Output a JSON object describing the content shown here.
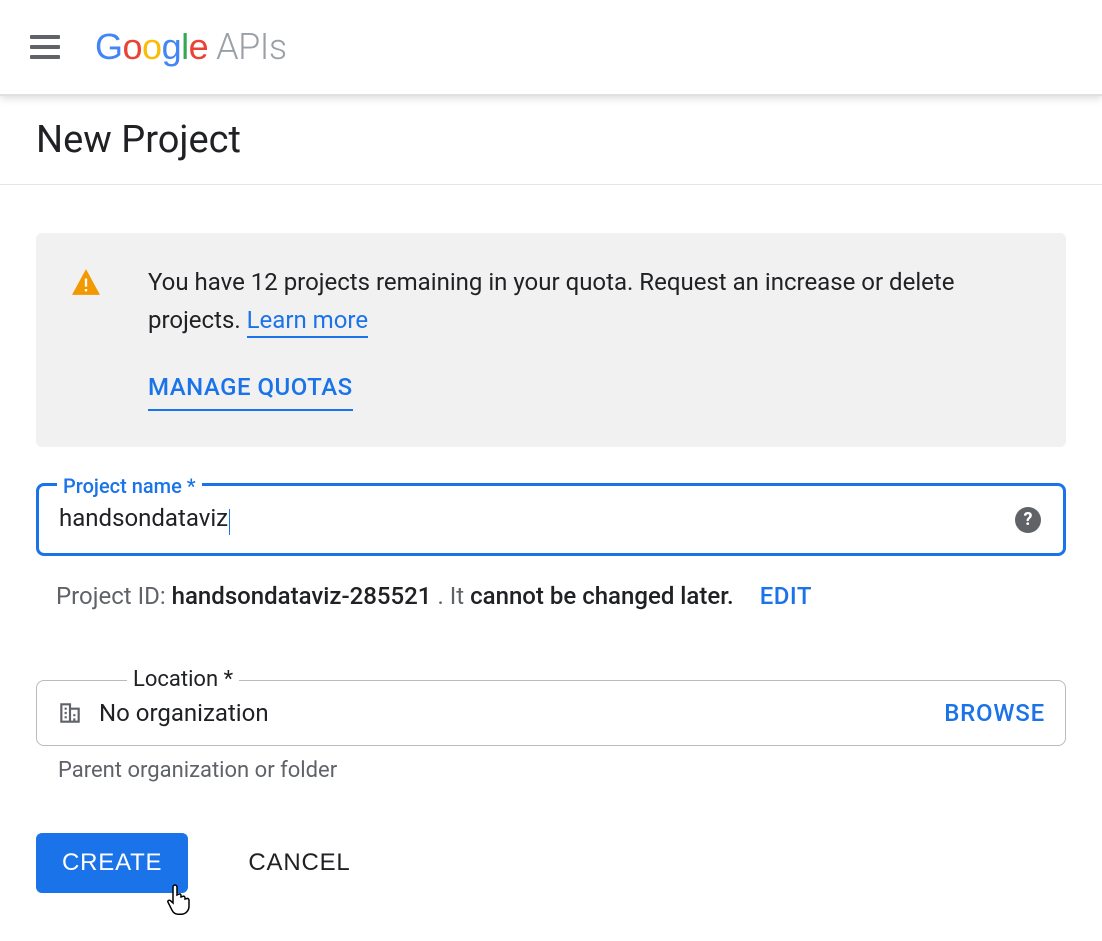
{
  "header": {
    "logo_suffix": "APIs"
  },
  "page": {
    "title": "New Project"
  },
  "alert": {
    "message_part1": "You have 12 projects remaining in your quota. Request an increase or delete projects. ",
    "learn_more": "Learn more",
    "manage_quotas": "MANAGE QUOTAS"
  },
  "project_name_field": {
    "label": "Project name *",
    "value": "handsondataviz"
  },
  "project_id_row": {
    "prefix": "Project ID:",
    "id": "handsondataviz-285521",
    "mid": ". It",
    "cannot": "cannot be changed later.",
    "edit": "EDIT"
  },
  "location_field": {
    "label": "Location *",
    "value": "No organization",
    "browse": "BROWSE",
    "helper": "Parent organization or folder"
  },
  "actions": {
    "create": "CREATE",
    "cancel": "CANCEL"
  }
}
